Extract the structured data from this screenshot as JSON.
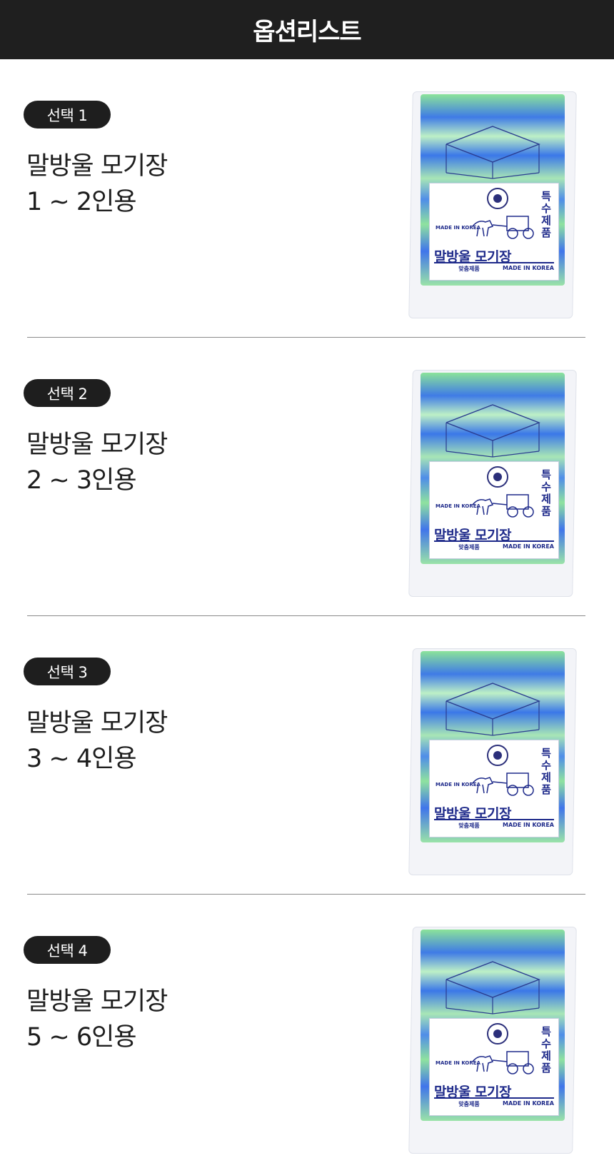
{
  "header": {
    "title": "옵션리스트"
  },
  "options": [
    {
      "badge": "선택 1",
      "name": "말방울 모기장",
      "size": "1 ~ 2인용"
    },
    {
      "badge": "선택 2",
      "name": "말방울 모기장",
      "size": "2 ~ 3인용"
    },
    {
      "badge": "선택 3",
      "name": "말방울 모기장",
      "size": "3 ~ 4인용"
    },
    {
      "badge": "선택 4",
      "name": "말방울 모기장",
      "size": "5 ~ 6인용"
    }
  ],
  "package_label": {
    "side_text": "특수제품",
    "made_in": "MADE IN KOREA",
    "brand": "말방울 모기장",
    "sub_center": "맞춤제품",
    "sub_right": "MADE IN KOREA"
  },
  "colors": {
    "header_bg": "#1f1f1f",
    "badge_bg": "#1e1e1e",
    "net_blue": "#3f7be6",
    "net_green": "#8be39a",
    "label_ink": "#1e2a8a"
  }
}
